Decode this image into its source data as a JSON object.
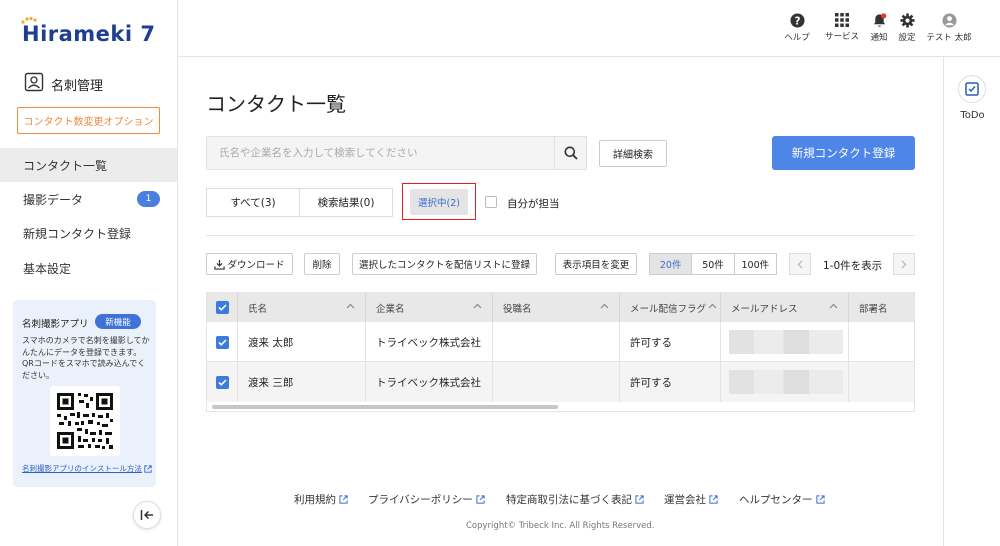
{
  "app": {
    "logo": "Hirameki 7"
  },
  "header": {
    "items": [
      {
        "label": "ヘルプ",
        "icon": "help-icon"
      },
      {
        "label": "サービス",
        "icon": "grid-icon"
      },
      {
        "label": "通知",
        "icon": "bell-icon"
      },
      {
        "label": "設定",
        "icon": "gear-icon"
      },
      {
        "label": "テスト 太郎",
        "icon": "user-icon"
      }
    ]
  },
  "sidebar": {
    "module_title": "名刺管理",
    "option_button": "コンタクト数変更オプション",
    "items": [
      {
        "label": "コンタクト一覧",
        "active": true
      },
      {
        "label": "撮影データ",
        "badge": "1"
      },
      {
        "label": "新規コンタクト登録"
      },
      {
        "label": "基本設定"
      }
    ],
    "promo": {
      "title": "名刺撮影アプリ",
      "tag": "新機能",
      "description": "スマホのカメラで名刺を撮影してかんたんにデータを登録できます。QRコードをスマホで読み込んでください。",
      "link": "名刺撮影アプリのインストール方法"
    }
  },
  "right_panel": {
    "todo_label": "ToDo"
  },
  "main": {
    "title": "コンタクト一覧",
    "search": {
      "placeholder": "氏名や企業名を入力して検索してください"
    },
    "advanced_search": "詳細検索",
    "new_contact": "新規コンタクト登録",
    "tabs": [
      {
        "label": "すべて(3)"
      },
      {
        "label": "検索結果(0)"
      }
    ],
    "selected_tab": "選択中(2)",
    "mine_checkbox_label": "自分が担当",
    "toolbar": {
      "download": "ダウンロード",
      "delete": "削除",
      "register_list": "選択したコンタクトを配信リストに登録",
      "change_columns": "表示項目を変更",
      "page_sizes": [
        "20件",
        "50件",
        "100件"
      ],
      "active_page_size": "20件",
      "range": "1-0件を表示"
    },
    "table": {
      "columns": [
        "氏名",
        "企業名",
        "役職名",
        "メール配信フラグ",
        "メールアドレス",
        "部署名"
      ],
      "rows": [
        {
          "checked": true,
          "name": "渡来 太郎",
          "company": "トライベック株式会社",
          "title": "",
          "mail_flag": "許可する",
          "email": "",
          "department": ""
        },
        {
          "checked": true,
          "name": "渡来 三郎",
          "company": "トライベック株式会社",
          "title": "",
          "mail_flag": "許可する",
          "email": "",
          "department": ""
        }
      ]
    }
  },
  "footer": {
    "links": [
      "利用規約",
      "プライバシーポリシー",
      "特定商取引法に基づく表記",
      "運営会社",
      "ヘルプセンター"
    ],
    "copyright": "Copyright© Tribeck Inc. All Rights Reserved."
  },
  "colors": {
    "primary": "#4e86e8",
    "accent_orange": "#f08a3c",
    "highlight_red": "#e02020",
    "logo_navy": "#1e3f8f"
  }
}
